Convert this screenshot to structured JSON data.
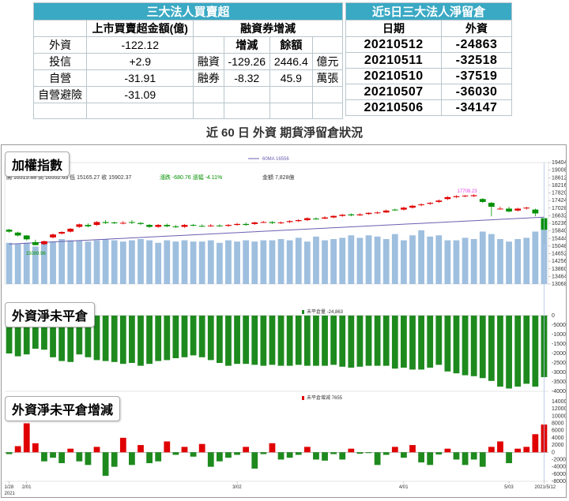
{
  "table_left": {
    "title": "三大法人買賣超",
    "col_amount": "上市買賣超金額(億)",
    "col_margin": "融資券增減",
    "col_change": "增減",
    "col_balance": "餘額",
    "rows": [
      {
        "label": "外資",
        "amount": "-122.12",
        "m_label": "",
        "m_change": "",
        "m_balance": "",
        "unit": ""
      },
      {
        "label": "投信",
        "amount": "+2.9",
        "m_label": "融資",
        "m_change": "-129.26",
        "m_balance": "2446.4",
        "unit": "億元"
      },
      {
        "label": "自營",
        "amount": "-31.91",
        "m_label": "融券",
        "m_change": "-8.32",
        "m_balance": "45.9",
        "unit": "萬張"
      },
      {
        "label": "自營避險",
        "amount": "-31.09",
        "m_label": "",
        "m_change": "",
        "m_balance": "",
        "unit": ""
      }
    ]
  },
  "table_right": {
    "title": "近5日三大法人淨留倉",
    "col_date": "日期",
    "col_foreign": "外資",
    "rows": [
      {
        "date": "20210512",
        "value": "-24863"
      },
      {
        "date": "20210511",
        "value": "-32518"
      },
      {
        "date": "20210510",
        "value": "-37519"
      },
      {
        "date": "20210507",
        "value": "-36030"
      },
      {
        "date": "20210506",
        "value": "-34147"
      }
    ]
  },
  "caption": "近 60 日 外資 期貨淨留倉狀況",
  "chart_data": [
    {
      "type": "candlestick",
      "title": "加權指數",
      "legend": "60MA 16556",
      "info": {
        "open": "開 16515.88",
        "high": "高 16552.63",
        "low": "低 15165.27",
        "close": "收 15902.37",
        "change": "漲跌 -680.76",
        "pct": "漲幅 -4.11%",
        "amount": "金額 7,828億"
      },
      "annotation_low": "15089.96",
      "annotation_high": "17709.23",
      "y_ticks": [
        "19404",
        "19008",
        "18612",
        "18216",
        "17820",
        "17424",
        "17028",
        "16632",
        "16236",
        "15840",
        "15444",
        "15048",
        "14652",
        "14256",
        "13860",
        "13464",
        "13068"
      ],
      "ylim": [
        13068,
        19404
      ],
      "up_color": "#e00000",
      "down_color": "#009000",
      "ma_color": "#6a5fb0",
      "volume_color": "#9fbfdf",
      "candles": [
        [
          15900,
          15800,
          15950,
          15750
        ],
        [
          15750,
          15600,
          15800,
          15550
        ],
        [
          15600,
          15400,
          15620,
          15330
        ],
        [
          15250,
          15100,
          15380,
          15090
        ],
        [
          15150,
          15300,
          15330,
          15100
        ],
        [
          15500,
          15650,
          15700,
          15450
        ],
        [
          15700,
          15780,
          15820,
          15650
        ],
        [
          15800,
          15950,
          15990,
          15760
        ],
        [
          16050,
          16180,
          16220,
          16000
        ],
        [
          16150,
          16080,
          16230,
          16030
        ],
        [
          16150,
          16300,
          16350,
          16100
        ],
        [
          16300,
          16250,
          16400,
          16200
        ],
        [
          16280,
          16250,
          16320,
          16200
        ],
        [
          16250,
          16260,
          16350,
          16180
        ],
        [
          16300,
          16270,
          16400,
          16200
        ],
        [
          16250,
          16200,
          16300,
          16150
        ],
        [
          16150,
          16050,
          16200,
          16000
        ],
        [
          16050,
          16150,
          16200,
          16000
        ],
        [
          16150,
          16080,
          16220,
          16030
        ],
        [
          16070,
          16050,
          16150,
          16000
        ],
        [
          16050,
          16150,
          16200,
          16000
        ],
        [
          16150,
          16120,
          16200,
          16080
        ],
        [
          16100,
          16080,
          16180,
          16050
        ],
        [
          16100,
          16120,
          16200,
          16050
        ],
        [
          16120,
          16100,
          16180,
          16050
        ],
        [
          16100,
          16150,
          16200,
          16050
        ],
        [
          16150,
          16200,
          16250,
          16100
        ],
        [
          16200,
          16150,
          16280,
          16100
        ],
        [
          16200,
          16280,
          16320,
          16150
        ],
        [
          16280,
          16300,
          16350,
          16250
        ],
        [
          16300,
          16250,
          16350,
          16200
        ],
        [
          16250,
          16280,
          16330,
          16200
        ],
        [
          16300,
          16350,
          16400,
          16250
        ],
        [
          16350,
          16400,
          16450,
          16300
        ],
        [
          16400,
          16500,
          16550,
          16350
        ],
        [
          16480,
          16470,
          16550,
          16420
        ],
        [
          16480,
          16540,
          16600,
          16450
        ],
        [
          16540,
          16620,
          16650,
          16500
        ],
        [
          16620,
          16680,
          16720,
          16580
        ],
        [
          16700,
          16650,
          16750,
          16600
        ],
        [
          16650,
          16700,
          16760,
          16620
        ],
        [
          16720,
          16780,
          16800,
          16680
        ],
        [
          16780,
          16800,
          16850,
          16730
        ],
        [
          16800,
          16900,
          16950,
          16780
        ],
        [
          16950,
          16920,
          17000,
          16880
        ],
        [
          16950,
          17050,
          17100,
          16900
        ],
        [
          17050,
          17150,
          17200,
          17000
        ],
        [
          17180,
          17220,
          17280,
          17120
        ],
        [
          17250,
          17300,
          17350,
          17200
        ],
        [
          17350,
          17420,
          17480,
          17300
        ],
        [
          17500,
          17600,
          17650,
          17450
        ],
        [
          17600,
          17650,
          17700,
          17550
        ],
        [
          17650,
          17680,
          17709,
          17600
        ],
        [
          17650,
          17700,
          17750,
          17600
        ],
        [
          17500,
          17350,
          17550,
          17300
        ],
        [
          17300,
          17100,
          17350,
          16600
        ],
        [
          17000,
          17000,
          17100,
          16950
        ],
        [
          17000,
          16850,
          17100,
          16800
        ],
        [
          16900,
          17000,
          17050,
          16850
        ],
        [
          17050,
          17050,
          17100,
          16950
        ],
        [
          16950,
          16750,
          17000,
          16600
        ],
        [
          16500,
          15900,
          16550,
          15165
        ]
      ],
      "volumes": [
        3300,
        3200,
        3300,
        3000,
        3300,
        3400,
        3600,
        3500,
        3500,
        3400,
        3500,
        3600,
        3500,
        3400,
        3500,
        3600,
        3500,
        3300,
        3500,
        3400,
        3500,
        3400,
        3400,
        3500,
        3300,
        3500,
        3400,
        3500,
        3400,
        3500,
        3500,
        3600,
        3500,
        3700,
        3400,
        3800,
        3500,
        3600,
        3700,
        3900,
        3700,
        3900,
        3800,
        3600,
        4000,
        3500,
        3900,
        4300,
        3800,
        3900,
        3500,
        3500,
        3700,
        3600,
        4200,
        4000,
        3600,
        3400,
        3600,
        3700,
        4200,
        5200
      ]
    },
    {
      "type": "bar",
      "title": "外資淨未平倉",
      "legend": "未平倉量 -24,863",
      "bar_color": "#1e8a1e",
      "y_ticks": [
        "0",
        "-5000",
        "-10000",
        "-15000",
        "-20000",
        "-25000",
        "-30000",
        "-35000",
        "-40000"
      ],
      "ylim": [
        -40000,
        0
      ],
      "values": [
        -20000,
        -21500,
        -20500,
        -17500,
        -18000,
        -22000,
        -24000,
        -24500,
        -20500,
        -22000,
        -23500,
        -24000,
        -24500,
        -25500,
        -25000,
        -26500,
        -25500,
        -24000,
        -23500,
        -22500,
        -22000,
        -21000,
        -22000,
        -23500,
        -25000,
        -26500,
        -25500,
        -25500,
        -26000,
        -26500,
        -26000,
        -26500,
        -26500,
        -26000,
        -26500,
        -26500,
        -26500,
        -26000,
        -27000,
        -27500,
        -27000,
        -26500,
        -26500,
        -26500,
        -28000,
        -27500,
        -28500,
        -28500,
        -27500,
        -26000,
        -29500,
        -30500,
        -31500,
        -32000,
        -33000,
        -34500,
        -37500,
        -38500,
        -37500,
        -36000,
        -37500,
        -32500,
        -24863
      ]
    },
    {
      "type": "bar",
      "title": "外資淨未平倉增減",
      "legend": "未平倉增減 7655",
      "up_color": "#e00000",
      "down_color": "#1e8a1e",
      "y_ticks": [
        "14000",
        "12000",
        "10000",
        "8000",
        "6000",
        "4000",
        "2000",
        "0",
        "-2000",
        "-4000",
        "-6000",
        "-8000"
      ],
      "ylim": [
        -8000,
        14000
      ],
      "values": [
        -500,
        1700,
        8000,
        2500,
        -2500,
        -1500,
        -3000,
        1000,
        -2500,
        -3500,
        1500,
        -6500,
        -4000,
        4000,
        -3500,
        2000,
        -3000,
        -2500,
        3000,
        -700,
        1500,
        -1200,
        2300,
        -4000,
        -2500,
        -1500,
        -700,
        1500,
        -4500,
        -500,
        2500,
        -2000,
        -1500,
        -700,
        1500,
        -2000,
        -2300,
        -500,
        -2000,
        1000,
        -400,
        -200,
        -3500,
        -700,
        1500,
        -1500,
        2000,
        -2800,
        -3500,
        -600,
        1000,
        -2000,
        -3500,
        -2000,
        -4000,
        1500,
        3000,
        -3000,
        1000,
        1500,
        5000,
        7655
      ],
      "x_ticks": [
        "1/28",
        "2/01",
        "3/02",
        "4/01",
        "5/03",
        "2021/5/12"
      ],
      "x_year": "2021"
    }
  ]
}
